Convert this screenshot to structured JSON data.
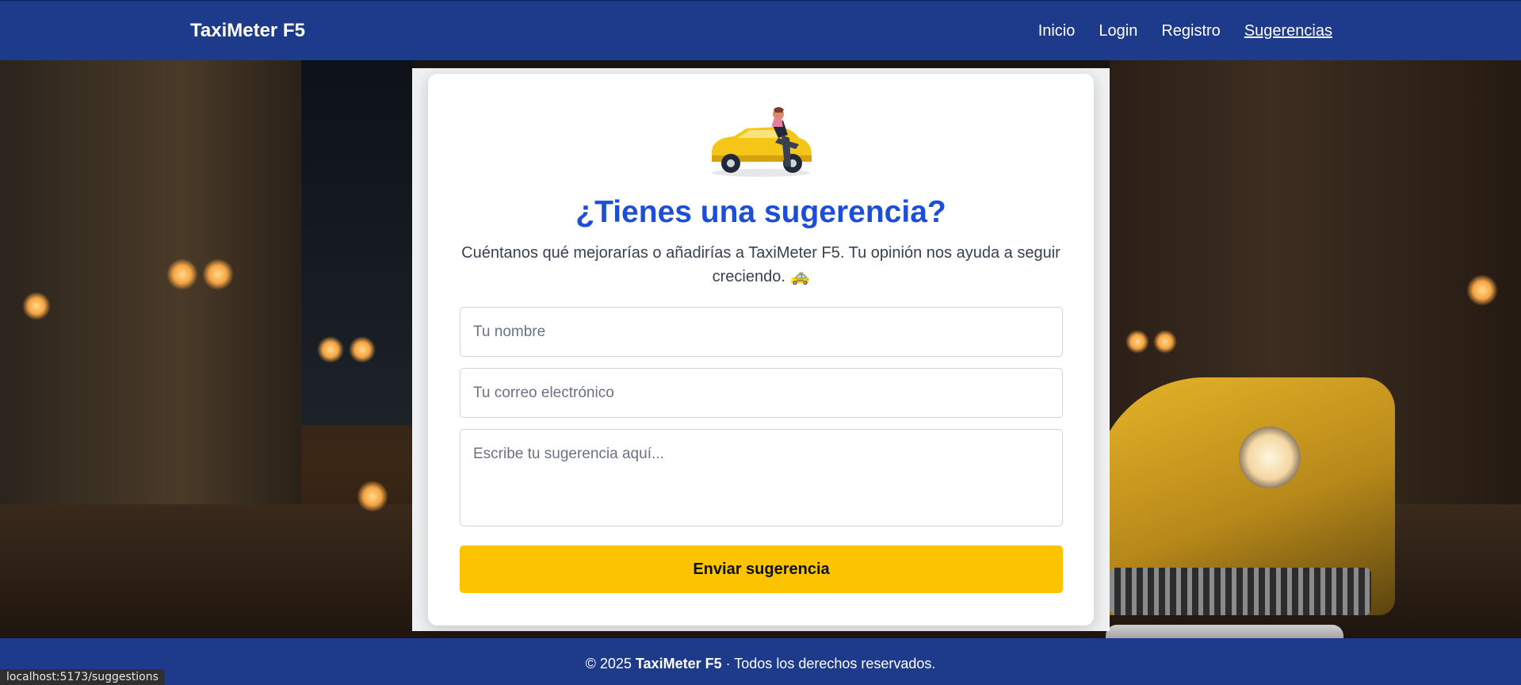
{
  "navbar": {
    "brand": "TaxiMeter F5",
    "links": [
      {
        "label": "Inicio"
      },
      {
        "label": "Login"
      },
      {
        "label": "Registro"
      },
      {
        "label": "Sugerencias",
        "active": true
      }
    ]
  },
  "form": {
    "title": "¿Tienes una sugerencia?",
    "subtitle": "Cuéntanos qué mejorarías o añadirías a TaxiMeter F5. Tu opinión nos ayuda a seguir creciendo. 🚕",
    "name_placeholder": "Tu nombre",
    "email_placeholder": "Tu correo electrónico",
    "suggestion_placeholder": "Escribe tu sugerencia aquí...",
    "submit_label": "Enviar sugerencia",
    "illustration": "person-sitting-on-yellow-car-illustration"
  },
  "footer": {
    "year": "© 2025",
    "brand": "TaxiMeter F5",
    "rights": "· Todos los derechos reservados."
  },
  "statusbar": {
    "url": "localhost:5173/suggestions"
  },
  "colors": {
    "primary": "#1e3a8a",
    "title": "#1d4ed8",
    "button": "#fcc300"
  }
}
